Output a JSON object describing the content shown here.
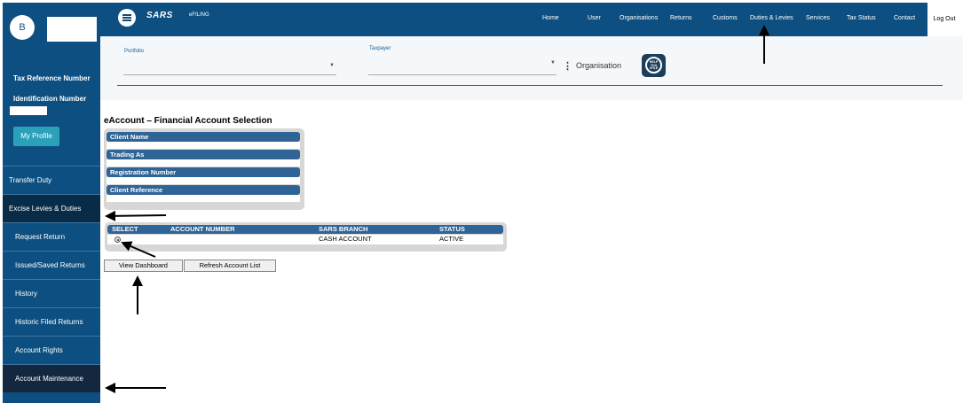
{
  "sidebar": {
    "avatar_letter": "B",
    "tax_reference_label": "Tax Reference Number",
    "identification_label": "Identification Number",
    "profile_button": "My Profile",
    "items": [
      {
        "label": "Transfer Duty"
      },
      {
        "label": "Excise Levies & Duties"
      },
      {
        "label": "Request Return"
      },
      {
        "label": "Issued/Saved Returns"
      },
      {
        "label": "History"
      },
      {
        "label": "Historic Filed Returns"
      },
      {
        "label": "Account Rights"
      },
      {
        "label": "Account Maintenance"
      }
    ]
  },
  "header": {
    "logo_text": "SARS",
    "logo_sub": "eFILING",
    "nav": [
      "Home",
      "User",
      "Organisations",
      "Returns",
      "Customs",
      "Duties & Levies",
      "Services",
      "Tax Status",
      "Contact"
    ],
    "logout": "Log Out"
  },
  "filters": {
    "portfolio_label": "Portfolio",
    "taxpayer_label": "Taxpayer",
    "organisation_text": "Organisation",
    "help_icon_text": "HELP YOU eFILE"
  },
  "main": {
    "heading": "eAccount – Financial Account Selection",
    "client_fields": [
      "Client Name",
      "Trading As",
      "Registration Number",
      "Client Reference"
    ],
    "account_table": {
      "columns": [
        "SELECT",
        "ACCOUNT NUMBER",
        "SARS BRANCH",
        "STATUS"
      ],
      "rows": [
        {
          "account_number": "",
          "branch": "CASH ACCOUNT",
          "status": "ACTIVE"
        }
      ]
    },
    "buttons": {
      "view_dashboard": "View Dashboard",
      "refresh": "Refresh Account List"
    }
  },
  "colors": {
    "brand_blue": "#0d4f80",
    "table_header": "#2f6496",
    "profile_button": "#2aa1b8"
  }
}
